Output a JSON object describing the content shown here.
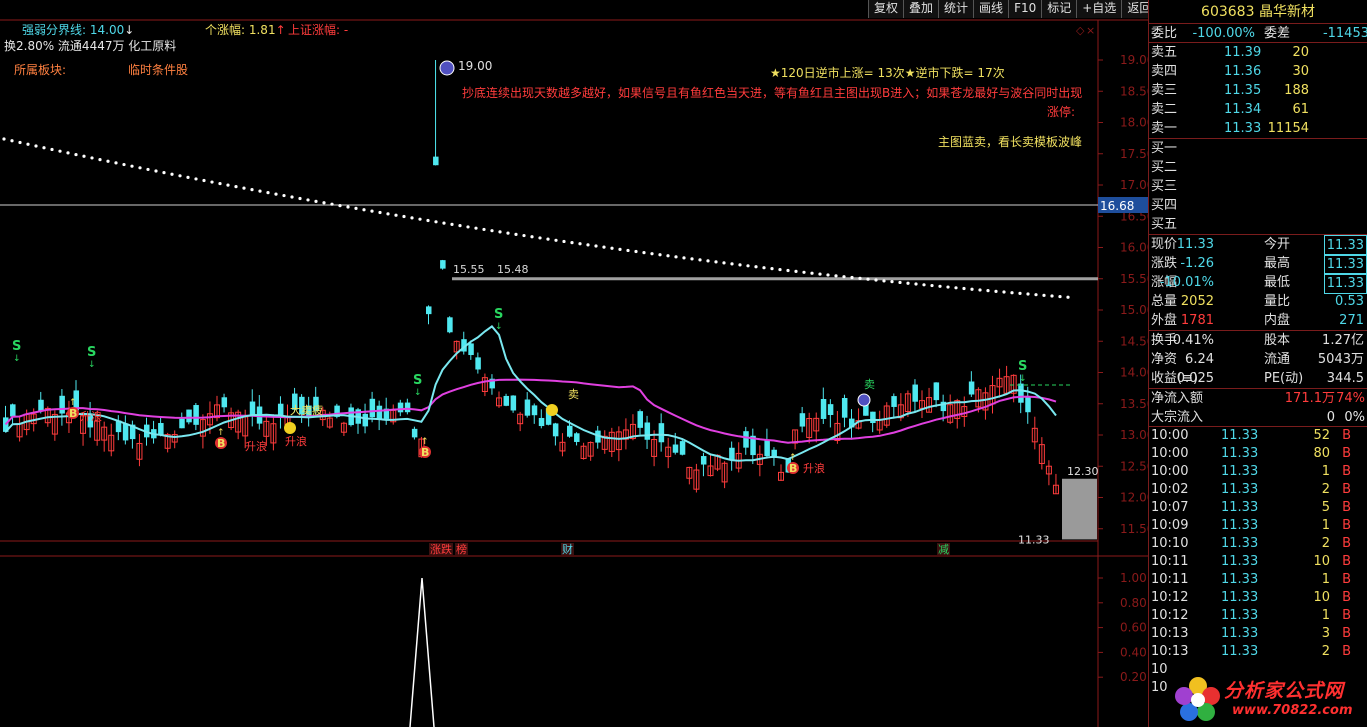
{
  "toolbar": {
    "buttons": [
      "复权",
      "叠加",
      "统计",
      "画线",
      "F10",
      "标记",
      "+自选",
      "返回"
    ]
  },
  "indicators": {
    "strength_label": "强弱分界线: 14.00",
    "strength_arrow": "↓",
    "turnover_line": "换2.80% 流通4447万 化工原料",
    "stock_change_label": "个涨幅: 1.81",
    "stock_change_arrow": "↑",
    "index_change_label": "上证涨幅: -",
    "sector_label": "所属板块:",
    "condition_label": "临时条件股",
    "stats_line": "★120日逆市上涨= 13次★逆市下跌= 17次",
    "hint_red_1": "抄底连续出现天数越多越好，如果信号且有鱼红色当天进，等有鱼红且主图出现B进入；如果苍龙最好与波谷同时出现",
    "hint_red_2": "涨停:",
    "hint_yellow": "主图蓝卖，看长卖模板波峰"
  },
  "price_axis": {
    "ticks": [
      "19.00",
      "18.50",
      "18.00",
      "17.50",
      "17.00",
      "16.50",
      "16.00",
      "15.50",
      "15.00",
      "14.50",
      "14.00",
      "13.50",
      "13.00",
      "12.50",
      "12.00",
      "11.50"
    ],
    "crosshair_value": "16.68"
  },
  "volume_axis": {
    "ticks": [
      "1.00",
      "0.80",
      "0.60",
      "0.40",
      "0.20"
    ]
  },
  "chart_labels": {
    "peak_price": "19.00",
    "level_low": "15.55",
    "level_high": "15.48",
    "last_high": "12.30",
    "last_close": "11.33",
    "s_marker": "S",
    "b_marker": "B",
    "up_wave": "主升浪",
    "up_wave_short": "升浪",
    "sell_text": "卖",
    "sell_dense": "大卖疲",
    "event_zhangdie": "涨跌",
    "event_bang": "榜",
    "event_cai": "财",
    "event_jian": "减"
  },
  "quote": {
    "code_name": "603683 晶华新材",
    "weibi_label": "委比",
    "weibi_value": "-100.00%",
    "weicha_label": "委差",
    "weicha_value": "-11453",
    "asks": [
      {
        "label": "卖五",
        "price": "11.39",
        "volume": "20"
      },
      {
        "label": "卖四",
        "price": "11.36",
        "volume": "30"
      },
      {
        "label": "卖三",
        "price": "11.35",
        "volume": "188"
      },
      {
        "label": "卖二",
        "price": "11.34",
        "volume": "61"
      },
      {
        "label": "卖一",
        "price": "11.33",
        "volume": "11154"
      }
    ],
    "bids": [
      {
        "label": "买一"
      },
      {
        "label": "买二"
      },
      {
        "label": "买三"
      },
      {
        "label": "买四"
      },
      {
        "label": "买五"
      }
    ],
    "stats": [
      {
        "l1": "现价",
        "v1": "11.33",
        "l2": "今开",
        "v2": "11.33"
      },
      {
        "l1": "涨跌",
        "v1": "-1.26",
        "l2": "最高",
        "v2": "11.33"
      },
      {
        "l1": "涨幅",
        "v1": "-10.01%",
        "l2": "最低",
        "v2": "11.33"
      },
      {
        "l1": "总量",
        "v1": "2052",
        "l2": "量比",
        "v2": "0.53"
      },
      {
        "l1": "外盘",
        "v1": "1781",
        "l2": "内盘",
        "v2": "271"
      }
    ],
    "stats2": [
      {
        "l1": "换手",
        "v1": "0.41%",
        "l2": "股本",
        "v2": "1.27亿"
      },
      {
        "l1": "净资",
        "v1": "6.24",
        "l2": "流通",
        "v2": "5043万"
      },
      {
        "l1": "收益(≡)",
        "v1": "0.025",
        "l2": "PE(动)",
        "v2": "344.5"
      }
    ],
    "net_inflow_label": "净流入额",
    "net_inflow_value": "171.1万",
    "net_inflow_pct": "74%",
    "big_inflow_label": "大宗流入",
    "big_inflow_value": "0",
    "big_inflow_pct": "0%"
  },
  "ticks": [
    {
      "time": "10:00",
      "price": "11.33",
      "vol": "52",
      "dir": "B"
    },
    {
      "time": "10:00",
      "price": "11.33",
      "vol": "80",
      "dir": "B"
    },
    {
      "time": "10:00",
      "price": "11.33",
      "vol": "1",
      "dir": "B"
    },
    {
      "time": "10:02",
      "price": "11.33",
      "vol": "2",
      "dir": "B"
    },
    {
      "time": "10:07",
      "price": "11.33",
      "vol": "5",
      "dir": "B"
    },
    {
      "time": "10:09",
      "price": "11.33",
      "vol": "1",
      "dir": "B"
    },
    {
      "time": "10:10",
      "price": "11.33",
      "vol": "2",
      "dir": "B"
    },
    {
      "time": "10:11",
      "price": "11.33",
      "vol": "10",
      "dir": "B"
    },
    {
      "time": "10:11",
      "price": "11.33",
      "vol": "1",
      "dir": "B"
    },
    {
      "time": "10:12",
      "price": "11.33",
      "vol": "10",
      "dir": "B"
    },
    {
      "time": "10:12",
      "price": "11.33",
      "vol": "1",
      "dir": "B"
    },
    {
      "time": "10:13",
      "price": "11.33",
      "vol": "3",
      "dir": "B"
    },
    {
      "time": "10:13",
      "price": "11.33",
      "vol": "2",
      "dir": "B"
    },
    {
      "time": "10",
      "price": "",
      "vol": "",
      "dir": ""
    },
    {
      "time": "10",
      "price": "",
      "vol": "",
      "dir": ""
    }
  ],
  "watermark": {
    "text": "分析家公式网",
    "url": "www.70822.com"
  },
  "colors": {
    "up": "#ff3c3c",
    "down": "#4fe8f0",
    "ma_magenta": "#e040e0",
    "ma_cyan": "#7ae8f0",
    "dots": "#ffffff",
    "axis": "#8b1a1a"
  }
}
